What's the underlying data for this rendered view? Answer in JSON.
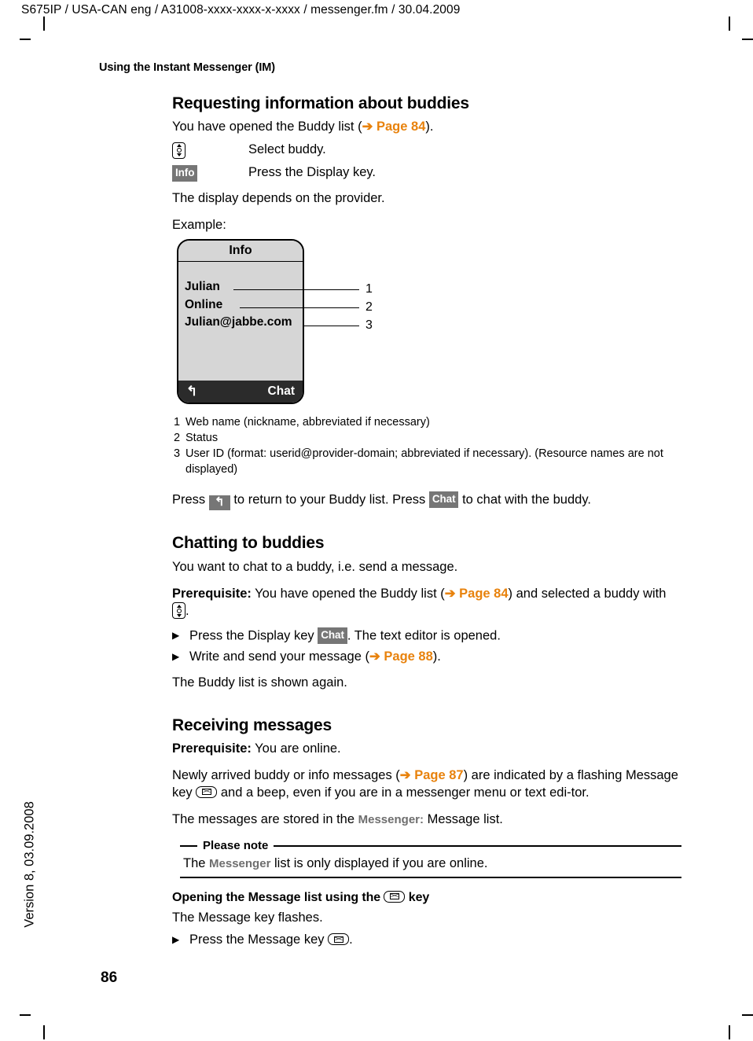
{
  "document": {
    "header_line": "S675IP  / USA-CAN eng / A31008-xxxx-xxxx-x-xxxx / messenger.fm / 30.04.2009",
    "version_label": "Version 8, 03.09.2008",
    "page_number": "86",
    "chapter_title": "Using the Instant Messenger (IM)"
  },
  "sections": {
    "requesting": {
      "heading": "Requesting information about buddies",
      "intro_prefix": "You have opened the Buddy list (",
      "intro_arrow": "➔",
      "intro_ref": "Page 84",
      "intro_suffix": ").",
      "steps": [
        {
          "icon": "nav-key-icon",
          "icon_label": "",
          "text": "Select buddy."
        },
        {
          "icon": "softkey-info",
          "icon_label": "Info",
          "text": "Press the Display key."
        }
      ],
      "provider_note": "The display depends on the provider.",
      "example_label": "Example:"
    },
    "display_figure": {
      "title": "Info",
      "lines": [
        "Julian",
        "Online",
        "Julian@jabbe.com"
      ],
      "footer_left_icon": "back-arrow-icon",
      "footer_left_glyph": "↰",
      "footer_right": "Chat",
      "callouts": [
        "1",
        "2",
        "3"
      ],
      "legend": [
        {
          "num": "1",
          "text": "Web name (nickname, abbreviated if necessary)"
        },
        {
          "num": "2",
          "text": "Status"
        },
        {
          "num": "3",
          "text": "User ID (format: userid@provider-domain; abbreviated if necessary). (Resource names are not displayed)"
        }
      ]
    },
    "return_paragraph": {
      "part1": "Press ",
      "back_key_glyph": "↰",
      "part2": " to return to your Buddy list. Press ",
      "chat_key": "Chat",
      "part3": " to chat with the buddy."
    },
    "chatting": {
      "heading": "Chatting to buddies",
      "intro": "You want to chat to a buddy, i.e. send a message.",
      "prereq_label": "Prerequisite:",
      "prereq_text_1": " You have opened the Buddy list (",
      "prereq_arrow": "➔",
      "prereq_ref": "Page 84",
      "prereq_text_2": ") and selected a buddy with ",
      "prereq_text_3": ".",
      "bullets": [
        {
          "glyph": "▶",
          "prefix": "Press the Display key ",
          "key": "Chat",
          "suffix": ". The text editor is opened."
        },
        {
          "glyph": "▶",
          "prefix": "Write and send your message (",
          "arrow": "➔",
          "ref": "Page 88",
          "suffix": ")."
        }
      ],
      "closing": "The Buddy list is shown again."
    },
    "receiving": {
      "heading": "Receiving messages",
      "prereq_label": "Prerequisite:",
      "prereq_text": " You are online.",
      "para_part1": "Newly arrived buddy or info messages (",
      "para_arrow": "➔",
      "para_ref": "Page 87",
      "para_part2": ") are indicated by a flashing Message key ",
      "para_part3": " and a beep, even if you are in a messenger menu or text edi-tor.",
      "stored_prefix": "The messages are stored in the ",
      "stored_term": "Messenger:",
      "stored_suffix": " Message list."
    },
    "note_box": {
      "title": "Please note",
      "body_prefix": "The ",
      "body_term": "Messenger",
      "body_suffix": " list is only displayed if you are online."
    },
    "opening_message_list": {
      "heading_part1": "Opening the Message list using the ",
      "heading_key": "message-key-icon",
      "heading_part2": " key",
      "line": "The Message key flashes.",
      "bullet": {
        "glyph": "▶",
        "prefix": "Press the Message key ",
        "suffix": "."
      }
    }
  },
  "colors": {
    "cross_reference": "#E8820C",
    "softkey_background": "#767676",
    "display_background": "#d6d6d6",
    "display_footer": "#2b2b2b",
    "ui_term_gray": "#6E6E6E"
  }
}
